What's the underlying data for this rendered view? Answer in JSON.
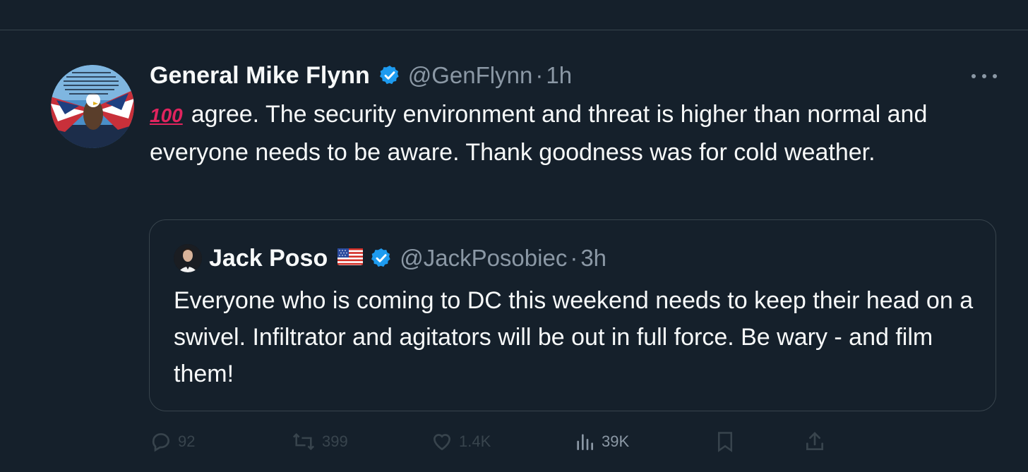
{
  "tweet": {
    "author_name": "General Mike Flynn",
    "author_handle": "@GenFlynn",
    "separator": "·",
    "time": "1h",
    "emoji_text": "100",
    "text": "agree. The security environment and threat is higher than normal and everyone needs to be aware. Thank goodness was for cold weather."
  },
  "quote": {
    "author_name": "Jack Poso",
    "author_handle": "@JackPosobiec",
    "separator": "·",
    "time": "3h",
    "text": "Everyone who is coming to DC this weekend needs to keep their head on a swivel. Infiltrator and agitators will be out in full force. Be wary - and film them!"
  },
  "actions": {
    "replies": "92",
    "retweets": "399",
    "likes": "1.4K",
    "views": "39K"
  },
  "icons": {
    "verified": "verified-badge-icon",
    "more": "more-icon",
    "reply": "reply-icon",
    "retweet": "retweet-icon",
    "like": "heart-icon",
    "views": "views-icon",
    "bookmark": "bookmark-icon",
    "share": "share-icon"
  },
  "colors": {
    "background": "#15202b",
    "text": "#f7f9f9",
    "muted": "#8b98a5",
    "border": "#38444d",
    "verified": "#1d9bf0"
  }
}
